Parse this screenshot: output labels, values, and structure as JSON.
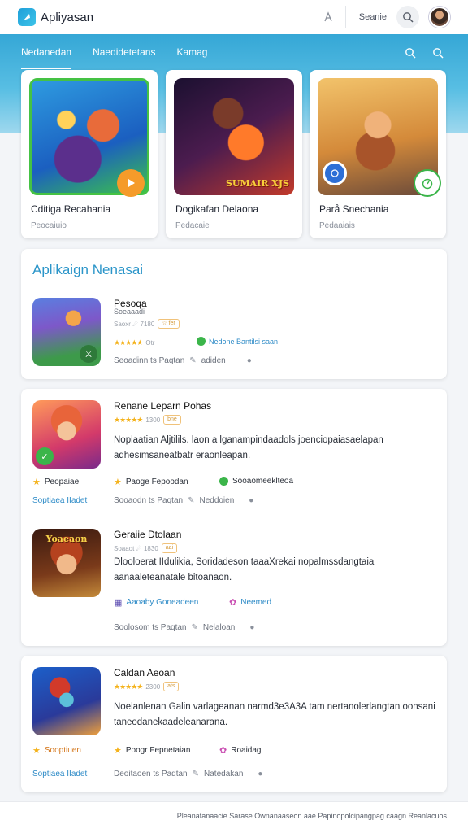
{
  "app": {
    "title": "Apliyasan"
  },
  "topbar": {
    "search_label": "Seanie"
  },
  "nav": {
    "tabs": [
      "Nedanedan",
      "Naedidetetans",
      "Kamag"
    ]
  },
  "featured": [
    {
      "name": "Cditiga Recahania",
      "sub": "Peocaiuio"
    },
    {
      "name": "Dogikafan Delaona",
      "sub": "Pedacaie",
      "art_text": "SUMAIR XJS"
    },
    {
      "name": "Parå Snechania",
      "sub": "Pedaaiais"
    }
  ],
  "section": {
    "title": "Aplikaign Nenasai"
  },
  "items": [
    {
      "title": "Pesoqa",
      "sub": "Soeaaadi",
      "rating_text": "Saoxr ☄ 7180",
      "pill": "☆ fer",
      "stars": "★★★★★",
      "count": "Otr",
      "link": "Nedone Bantilsi saan",
      "foot1": "Seoadinn ts Paqtan",
      "foot2": "adiden"
    },
    {
      "title": "Renane Leparn Pohas",
      "stars": "★★★★★",
      "count": "1300",
      "pill": "bne",
      "desc": "Noplaatian Aljtilils.  laon a lganampindaadols  joenciopaiasaelapan adhesimsaneatbatr eraonleapan.",
      "chip1": "Peopaiae",
      "chip2": "Paoge Fepoodan",
      "chip3": "Sooaomeeklteoa",
      "blue": "Soptiaea IIadet",
      "foot1": "Sooaodn ts Paqtan",
      "foot2": "Neddoien"
    },
    {
      "title": "Geraiie Dtolaan",
      "sub": "Soaaot  ☄ 1830",
      "pill": "aai",
      "thumb_text": "Yoaeaon",
      "desc": "Dlooloerat IIdulikia,  Soridadeson  taaaXrekai  nopalmssdangtaia aanaaleteanatale bitoanaon.",
      "chip1": "Aaoaby Goneadeen",
      "chip2": "Neemed",
      "foot1": "Soolosom ts Paqtan",
      "foot2": "Nelaloan"
    },
    {
      "title": "Caldan Aeoan",
      "stars": "★★★★★",
      "count": "2300",
      "pill": "ats",
      "desc": "Noelanlenan Galin varlageanan  narmd3e3A3A  tam nertanolerlangtan oonsani taneodanekaadeleanarana.",
      "chip1": "Sooptiuen",
      "chip2": "Poogr Fepnetaian",
      "chip3": "Roaidag",
      "blue": "Soptiaea IIadet",
      "foot1": "Deoitaoen ts Paqtan",
      "foot2": "Natedakan"
    }
  ],
  "footer": {
    "text": "Pleanatanaacie Sarase Ownanaaseon aae Papinopolcipangpag  caagn Reanlacuos"
  },
  "colors": {
    "accent": "#2b95c9",
    "hero": "#35a7d6",
    "star": "#f4b21b",
    "green": "#3bb54a"
  }
}
